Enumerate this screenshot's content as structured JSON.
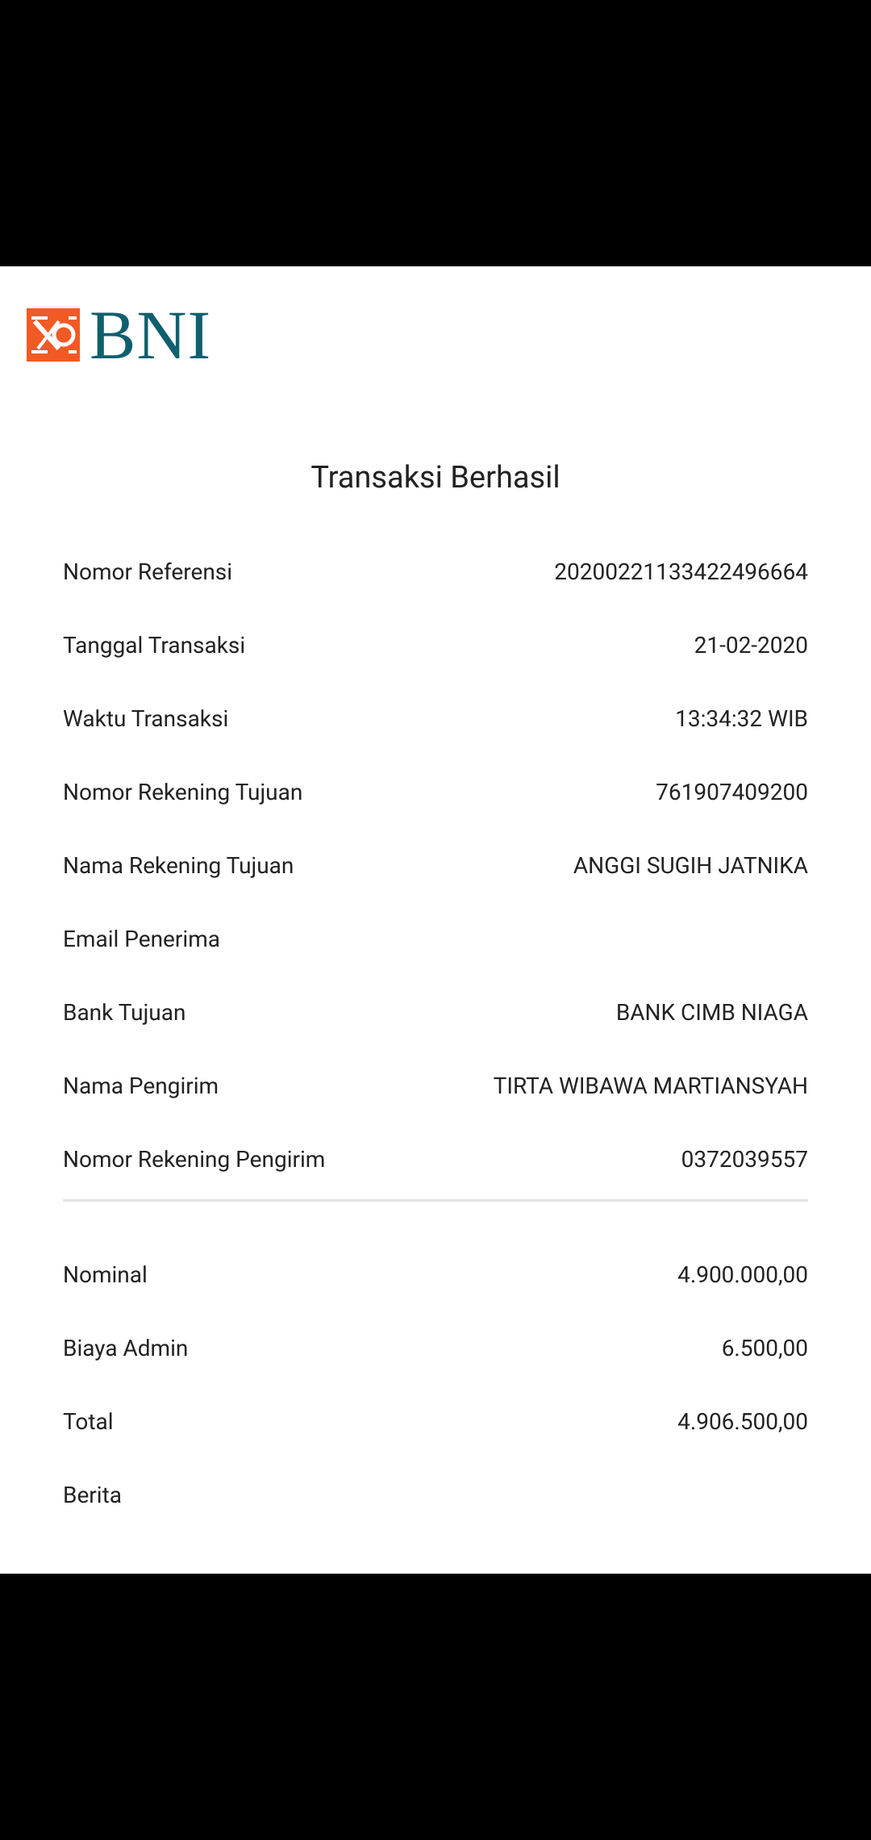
{
  "brand": {
    "logo_text": "BNI",
    "primary_color": "#0f5f6f",
    "accent_color": "#f15a24"
  },
  "receipt": {
    "title": "Transaksi Berhasil",
    "details": [
      {
        "label": "Nomor Referensi",
        "value": "20200221133422496664"
      },
      {
        "label": "Tanggal Transaksi",
        "value": "21-02-2020"
      },
      {
        "label": "Waktu Transaksi",
        "value": "13:34:32 WIB"
      },
      {
        "label": "Nomor Rekening Tujuan",
        "value": "761907409200"
      },
      {
        "label": "Nama Rekening Tujuan",
        "value": "ANGGI SUGIH JATNIKA"
      },
      {
        "label": "Email Penerima",
        "value": ""
      },
      {
        "label": "Bank Tujuan",
        "value": "BANK CIMB NIAGA"
      },
      {
        "label": "Nama Pengirim",
        "value": "TIRTA WIBAWA MARTIANSYAH"
      },
      {
        "label": "Nomor Rekening Pengirim",
        "value": "0372039557"
      }
    ],
    "amounts": [
      {
        "label": "Nominal",
        "value": "4.900.000,00"
      },
      {
        "label": "Biaya Admin",
        "value": "6.500,00"
      },
      {
        "label": "Total",
        "value": "4.906.500,00"
      },
      {
        "label": "Berita",
        "value": ""
      }
    ]
  }
}
